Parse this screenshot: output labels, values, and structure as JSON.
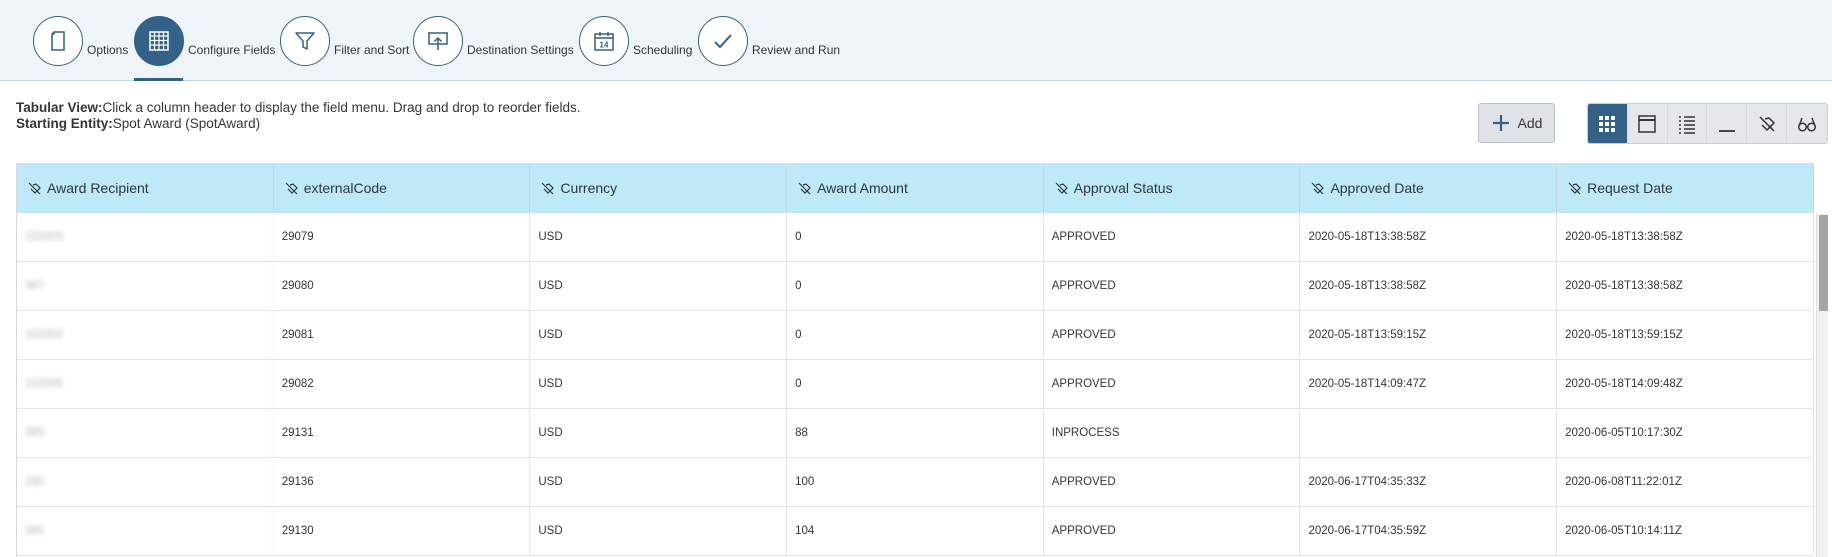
{
  "wizard": {
    "steps": [
      {
        "label": "Options",
        "icon": "document-icon",
        "active": false
      },
      {
        "label": "Configure Fields",
        "icon": "table-grid-icon",
        "active": true
      },
      {
        "label": "Filter and Sort",
        "icon": "filter-icon",
        "active": false
      },
      {
        "label": "Destination Settings",
        "icon": "upload-screen-icon",
        "active": false
      },
      {
        "label": "Scheduling",
        "icon": "calendar-icon",
        "active": false,
        "calendar_day": "14"
      },
      {
        "label": "Review and Run",
        "icon": "checkmark-icon",
        "active": false
      }
    ]
  },
  "info": {
    "tabular_label": "Tabular View:",
    "tabular_text": "Click a column header to display the field menu. Drag and drop to reorder fields.",
    "entity_label": "Starting Entity:",
    "entity_text": "Spot Award (SpotAward)"
  },
  "toolbar": {
    "add_label": "Add",
    "views": [
      {
        "icon": "grid-view-icon",
        "active": true
      },
      {
        "icon": "window-view-icon",
        "active": false
      },
      {
        "icon": "list-view-icon",
        "active": false
      },
      {
        "icon": "minimize-icon",
        "active": false
      },
      {
        "icon": "hide-fields-icon",
        "active": false
      },
      {
        "icon": "preview-glasses-icon",
        "active": false
      }
    ]
  },
  "table": {
    "columns": [
      "Award Recipient",
      "externalCode",
      "Currency",
      "Award Amount",
      "Approval Status",
      "Approved Date",
      "Request Date"
    ],
    "rows": [
      [
        "103305",
        "29079",
        "USD",
        "0",
        "APPROVED",
        "2020-05-18T13:38:58Z",
        "2020-05-18T13:38:58Z"
      ],
      [
        "367",
        "29080",
        "USD",
        "0",
        "APPROVED",
        "2020-05-18T13:38:58Z",
        "2020-05-18T13:38:58Z"
      ],
      [
        "103302",
        "29081",
        "USD",
        "0",
        "APPROVED",
        "2020-05-18T13:59:15Z",
        "2020-05-18T13:59:15Z"
      ],
      [
        "103305",
        "29082",
        "USD",
        "0",
        "APPROVED",
        "2020-05-18T14:09:47Z",
        "2020-05-18T14:09:48Z"
      ],
      [
        "365",
        "29131",
        "USD",
        "88",
        "INPROCESS",
        "",
        "2020-06-05T10:17:30Z"
      ],
      [
        "295",
        "29136",
        "USD",
        "100",
        "APPROVED",
        "2020-06-17T04:35:33Z",
        "2020-06-08T11:22:01Z"
      ],
      [
        "365",
        "29130",
        "USD",
        "104",
        "APPROVED",
        "2020-06-17T04:35:59Z",
        "2020-06-05T10:14:11Z"
      ]
    ]
  },
  "colors": {
    "accent": "#346187",
    "header_bg": "#eff4f9",
    "table_header_bg": "#bde9f8"
  }
}
